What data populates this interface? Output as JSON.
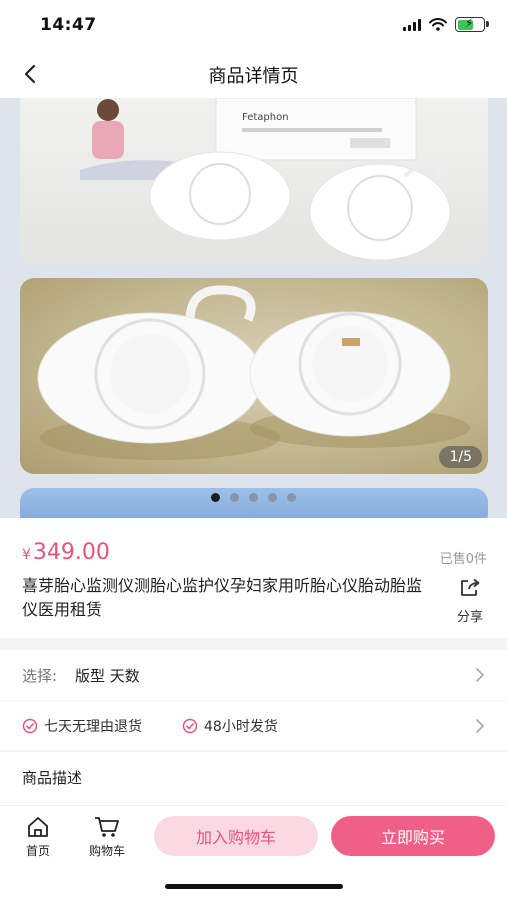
{
  "status_bar": {
    "time": "14:47"
  },
  "nav": {
    "title": "商品详情页"
  },
  "gallery": {
    "counter": "1/5",
    "dot_count": 5,
    "active_index": 0,
    "photo1_box_text": "Fetaphon"
  },
  "product": {
    "currency": "¥",
    "price": "349.00",
    "sold": "已售0件",
    "title": "喜芽胎心监测仪测胎心监护仪孕妇家用听胎心仪胎动胎监仪医用租赁",
    "share_label": "分享"
  },
  "spec": {
    "label": "选择:",
    "value": "版型  天数"
  },
  "promises": [
    "七天无理由退货",
    "48小时发货"
  ],
  "description": {
    "title": "商品描述"
  },
  "bottom_bar": {
    "home_label": "首页",
    "cart_label": "购物车",
    "add_to_cart": "加入购物车",
    "buy_now": "立即购买"
  },
  "colors": {
    "accent": "#ef5f87",
    "price": "#e8537a",
    "accent_light": "#fbd9e3"
  }
}
